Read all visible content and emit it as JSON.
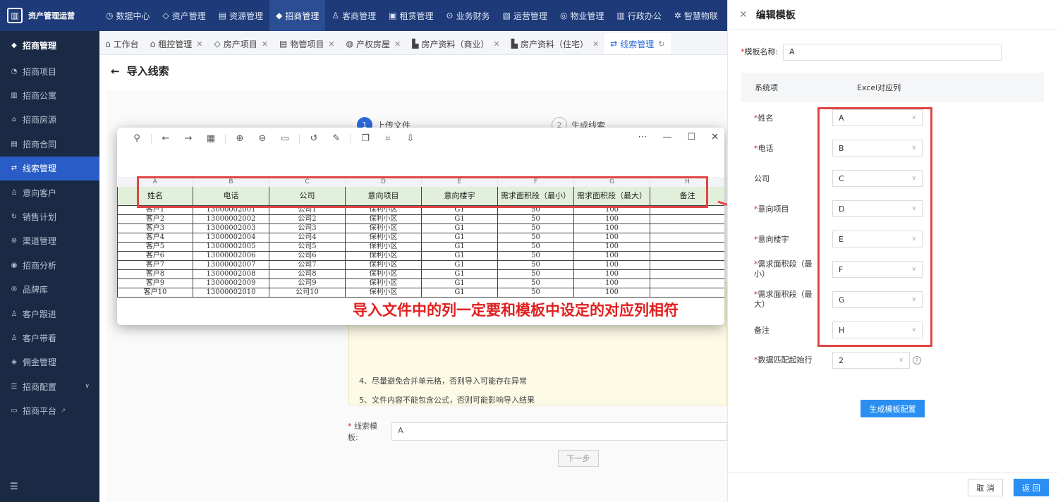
{
  "app": {
    "title": "资产管理运营"
  },
  "topnav": [
    {
      "icon": "dashboard-icon",
      "glyph": "◷",
      "label": "数据中心",
      "active": false
    },
    {
      "icon": "asset-icon",
      "glyph": "◇",
      "label": "资产管理",
      "active": false
    },
    {
      "icon": "resource-icon",
      "glyph": "▤",
      "label": "资源管理",
      "active": false
    },
    {
      "icon": "invest-icon",
      "glyph": "◆",
      "label": "招商管理",
      "active": true
    },
    {
      "icon": "customer-icon",
      "glyph": "♙",
      "label": "客商管理",
      "active": false
    },
    {
      "icon": "lease-icon",
      "glyph": "▣",
      "label": "租赁管理",
      "active": false
    },
    {
      "icon": "finance-icon",
      "glyph": "⊙",
      "label": "业务财务",
      "active": false
    },
    {
      "icon": "ops-icon",
      "glyph": "▧",
      "label": "运营管理",
      "active": false
    },
    {
      "icon": "property-icon",
      "glyph": "◎",
      "label": "物业管理",
      "active": false
    },
    {
      "icon": "office-icon",
      "glyph": "▥",
      "label": "行政办公",
      "active": false
    },
    {
      "icon": "smart-icon",
      "glyph": "✲",
      "label": "智慧物联",
      "active": false
    }
  ],
  "sidebar": {
    "header": "招商管理",
    "items": [
      {
        "icon": "project-icon",
        "glyph": "◔",
        "label": "招商项目",
        "active": false
      },
      {
        "icon": "apartment-icon",
        "glyph": "▥",
        "label": "招商公寓",
        "active": false
      },
      {
        "icon": "house-icon",
        "glyph": "⌂",
        "label": "招商房源",
        "active": false
      },
      {
        "icon": "contract-icon",
        "glyph": "▤",
        "label": "招商合同",
        "active": false
      },
      {
        "icon": "clue-icon",
        "glyph": "⇄",
        "label": "线索管理",
        "active": true
      },
      {
        "icon": "intent-customer-icon",
        "glyph": "♙",
        "label": "意向客户",
        "active": false
      },
      {
        "icon": "sales-plan-icon",
        "glyph": "↻",
        "label": "销售计划",
        "active": false
      },
      {
        "icon": "channel-icon",
        "glyph": "⊛",
        "label": "渠道管理",
        "active": false
      },
      {
        "icon": "analysis-icon",
        "glyph": "◉",
        "label": "招商分析",
        "active": false
      },
      {
        "icon": "brand-icon",
        "glyph": "®",
        "label": "品牌库",
        "active": false
      },
      {
        "icon": "follow-icon",
        "glyph": "♙",
        "label": "客户跟进",
        "active": false
      },
      {
        "icon": "visit-icon",
        "glyph": "♙",
        "label": "客户带看",
        "active": false
      },
      {
        "icon": "commission-icon",
        "glyph": "◈",
        "label": "佣金管理",
        "active": false
      },
      {
        "icon": "config-icon",
        "glyph": "☰",
        "label": "招商配置",
        "active": false
      },
      {
        "icon": "platform-icon",
        "glyph": "▭",
        "label": "招商平台",
        "active": false
      }
    ]
  },
  "tabs": [
    {
      "icon": "home-icon",
      "glyph": "⌂",
      "label": "工作台",
      "closable": false,
      "active": false
    },
    {
      "icon": "rent-control-icon",
      "glyph": "⌂",
      "label": "租控管理",
      "closable": true,
      "active": false
    },
    {
      "icon": "estate-icon",
      "glyph": "◇",
      "label": "房产项目",
      "closable": true,
      "active": false
    },
    {
      "icon": "property-project-icon",
      "glyph": "▤",
      "label": "物管项目",
      "closable": true,
      "active": false
    },
    {
      "icon": "title-icon",
      "glyph": "◍",
      "label": "产权房屋",
      "closable": true,
      "active": false
    },
    {
      "icon": "commercial-icon",
      "glyph": "▙",
      "label": "房产资料（商业）",
      "closable": true,
      "active": false
    },
    {
      "icon": "residential-icon",
      "glyph": "▙",
      "label": "房产资料（住宅）",
      "closable": true,
      "active": false
    },
    {
      "icon": "clue-tab-icon",
      "glyph": "⇄",
      "label": "线索管理",
      "closable": false,
      "active": true
    }
  ],
  "page": {
    "title": "导入线索",
    "steps": [
      {
        "num": "1",
        "label": "上传文件"
      },
      {
        "num": "2",
        "label": "生成线索"
      }
    ],
    "notice_lines": [
      "4、尽量避免合并单元格，否则导入可能存在异常",
      "5、文件内容不能包含公式，否则可能影响导入结果"
    ],
    "template_label": "线索模板:",
    "template_value": "A",
    "next_label": "下一步"
  },
  "viewer": {
    "letters": [
      "A",
      "B",
      "C",
      "D",
      "E",
      "F",
      "G",
      "H"
    ],
    "headers": [
      "姓名",
      "电话",
      "公司",
      "意向项目",
      "意向楼宇",
      "需求面积段（最小）",
      "需求面积段（最大）",
      "备注"
    ],
    "rows": [
      [
        "客户1",
        "13000002001",
        "公司1",
        "保利小区",
        "G1",
        "50",
        "100",
        ""
      ],
      [
        "客户2",
        "13000002002",
        "公司2",
        "保利小区",
        "G1",
        "50",
        "100",
        ""
      ],
      [
        "客户3",
        "13000002003",
        "公司3",
        "保利小区",
        "G1",
        "50",
        "100",
        ""
      ],
      [
        "客户4",
        "13000002004",
        "公司4",
        "保利小区",
        "G1",
        "50",
        "100",
        ""
      ],
      [
        "客户5",
        "13000002005",
        "公司5",
        "保利小区",
        "G1",
        "50",
        "100",
        ""
      ],
      [
        "客户6",
        "13000002006",
        "公司6",
        "保利小区",
        "G1",
        "50",
        "100",
        ""
      ],
      [
        "客户7",
        "13000002007",
        "公司7",
        "保利小区",
        "G1",
        "50",
        "100",
        ""
      ],
      [
        "客户8",
        "13000002008",
        "公司8",
        "保利小区",
        "G1",
        "50",
        "100",
        ""
      ],
      [
        "客户9",
        "13000002009",
        "公司9",
        "保利小区",
        "G1",
        "50",
        "100",
        ""
      ],
      [
        "客户10",
        "13000002010",
        "公司10",
        "保利小区",
        "G1",
        "50",
        "100",
        ""
      ]
    ],
    "annotation": "导入文件中的列一定要和模板中设定的对应列相符"
  },
  "drawer": {
    "title": "编辑模板",
    "name_label": "模板名称:",
    "name_value": "A",
    "col_system": "系统项",
    "col_excel": "Excel对应列",
    "mappings": [
      {
        "label": "姓名",
        "required": true,
        "value": "A"
      },
      {
        "label": "电话",
        "required": true,
        "value": "B"
      },
      {
        "label": "公司",
        "required": false,
        "value": "C"
      },
      {
        "label": "意向项目",
        "required": true,
        "value": "D"
      },
      {
        "label": "意向楼宇",
        "required": true,
        "value": "E"
      },
      {
        "label": "需求面积段（最小）",
        "required": true,
        "value": "F"
      },
      {
        "label": "需求面积段（最大）",
        "required": true,
        "value": "G"
      },
      {
        "label": "备注",
        "required": false,
        "value": "H"
      }
    ],
    "start_label": "数据匹配起始行",
    "start_value": "2",
    "generate_label": "生成模板配置",
    "cancel_label": "取 消",
    "back_label": "返 回"
  },
  "colors": {
    "accent": "#2a8ff0",
    "nav": "#1e3a78",
    "annotation": "#e02020"
  }
}
